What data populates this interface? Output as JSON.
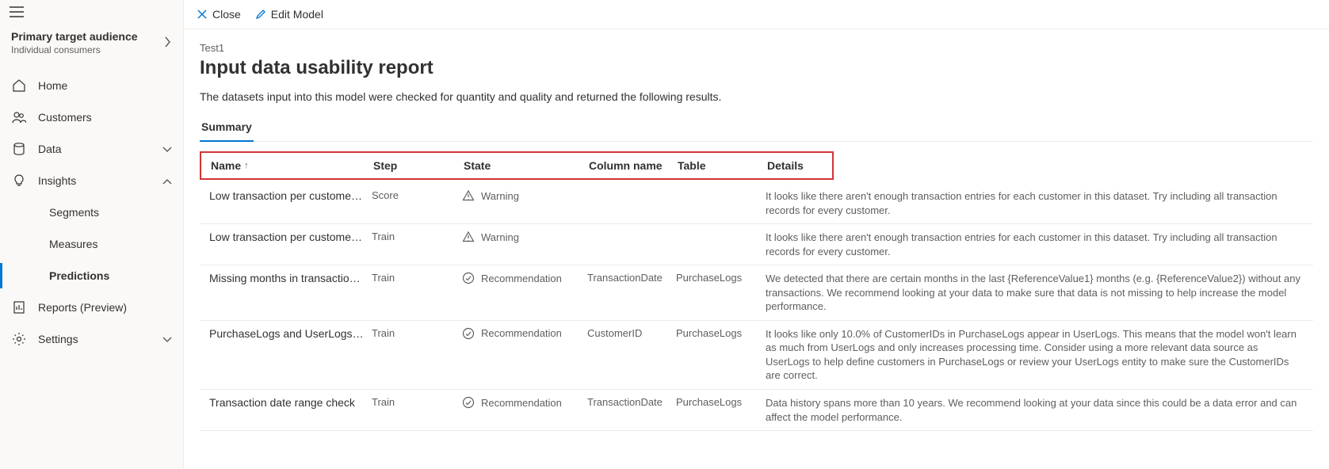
{
  "audience": {
    "title": "Primary target audience",
    "subtitle": "Individual consumers"
  },
  "sidebar": {
    "items": [
      {
        "label": "Home"
      },
      {
        "label": "Customers"
      },
      {
        "label": "Data"
      },
      {
        "label": "Insights"
      },
      {
        "label": "Segments"
      },
      {
        "label": "Measures"
      },
      {
        "label": "Predictions"
      },
      {
        "label": "Reports (Preview)"
      },
      {
        "label": "Settings"
      }
    ]
  },
  "commands": {
    "close": "Close",
    "edit": "Edit Model"
  },
  "breadcrumb": "Test1",
  "page_title": "Input data usability report",
  "page_desc": "The datasets input into this model were checked for quantity and quality and returned the following results.",
  "tab_summary": "Summary",
  "columns": {
    "name": "Name",
    "step": "Step",
    "state": "State",
    "column": "Column name",
    "table": "Table",
    "details": "Details"
  },
  "rows": [
    {
      "name": "Low transaction per customer (s...",
      "step": "Score",
      "state": "Warning",
      "state_icon": "warning",
      "column": "",
      "table": "",
      "details": "It looks like there aren't enough transaction entries for each customer in this dataset. Try including all transaction records for every customer."
    },
    {
      "name": "Low transaction per customer (s...",
      "step": "Train",
      "state": "Warning",
      "state_icon": "warning",
      "column": "",
      "table": "",
      "details": "It looks like there aren't enough transaction entries for each customer in this dataset. Try including all transaction records for every customer."
    },
    {
      "name": "Missing months in transactions ...",
      "step": "Train",
      "state": "Recommendation",
      "state_icon": "recommendation",
      "column": "TransactionDate",
      "table": "PurchaseLogs",
      "details": "We detected that there are certain months in the last {ReferenceValue1} months (e.g. {ReferenceValue2}) without any transactions. We recommend looking at your data to make sure that data is not missing to help increase the model performance."
    },
    {
      "name": "PurchaseLogs and UserLogs cus...",
      "step": "Train",
      "state": "Recommendation",
      "state_icon": "recommendation",
      "column": "CustomerID",
      "table": "PurchaseLogs",
      "details": "It looks like only 10.0% of CustomerIDs in PurchaseLogs appear in UserLogs. This means that the model won't learn as much from UserLogs and only increases processing time. Consider using a more relevant data source as UserLogs to help define customers in PurchaseLogs or review your UserLogs entity to make sure the CustomerIDs are correct."
    },
    {
      "name": "Transaction date range check",
      "step": "Train",
      "state": "Recommendation",
      "state_icon": "recommendation",
      "column": "TransactionDate",
      "table": "PurchaseLogs",
      "details": "Data history spans more than 10 years. We recommend looking at your data since this could be a data error and can affect the model performance."
    }
  ]
}
